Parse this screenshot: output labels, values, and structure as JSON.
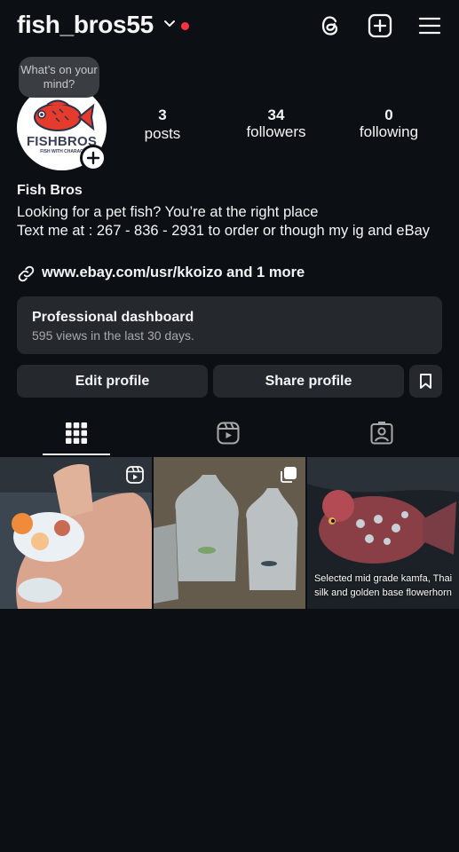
{
  "header": {
    "username": "fish_bros55",
    "icons": [
      "threads-icon",
      "plus-square-icon",
      "menu-icon"
    ]
  },
  "profile": {
    "note": "What’s on your mind?",
    "avatar_text": "FISHBROS",
    "avatar_subtext": "FISH WITH CHARAC",
    "stats": [
      {
        "value": "3",
        "label": "posts"
      },
      {
        "value": "34",
        "label": "followers"
      },
      {
        "value": "0",
        "label": "following"
      }
    ]
  },
  "bio": {
    "name": "Fish Bros",
    "line1": "Looking for a pet fish? You’re at the right place",
    "line2": "Text me at : 267 - 836 - 2931 to order or though my ig and eBay",
    "link": "www.ebay.com/usr/kkoizo and 1 more"
  },
  "dashboard": {
    "title": "Professional dashboard",
    "subtitle": "595 views in the last 30 days."
  },
  "actions": {
    "edit": "Edit profile",
    "share": "Share profile"
  },
  "tabs": [
    "grid-icon",
    "reels-icon",
    "tagged-icon"
  ],
  "posts": [
    {
      "type": "reel",
      "caption": ""
    },
    {
      "type": "carousel",
      "caption": ""
    },
    {
      "type": "image",
      "caption": "Selected mid grade kamfa, Thai silk and golden base flowerhorn"
    }
  ],
  "colors": {
    "background": "#0c1014",
    "button": "#25292e",
    "live_dot": "#ff3040",
    "secondary_text": "#a8a8a8"
  }
}
